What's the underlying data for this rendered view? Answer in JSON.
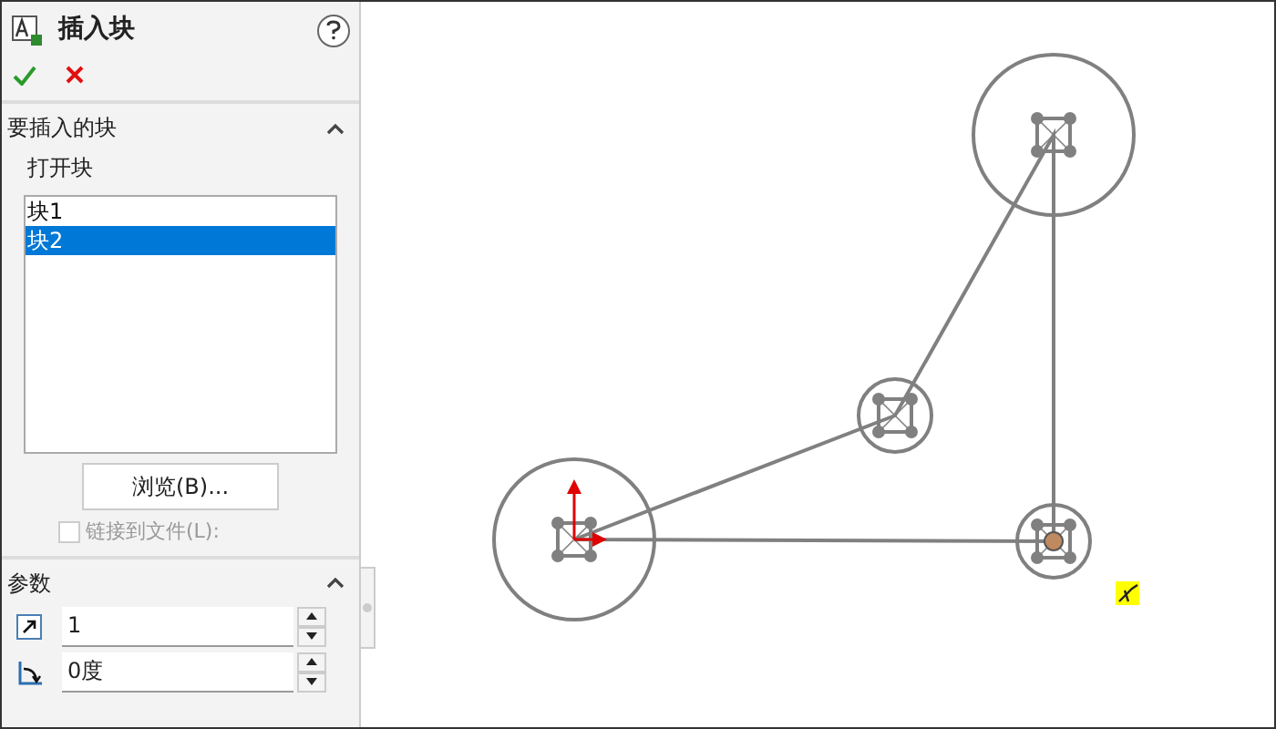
{
  "panel": {
    "title": "插入块",
    "sections": [
      {
        "kind": "blocks",
        "title": "要插入的块",
        "expanded": true,
        "subtitle": "打开块",
        "items": [
          {
            "label": "块1",
            "selected": false
          },
          {
            "label": "块2",
            "selected": true
          }
        ],
        "button": "浏览(B)...",
        "link": {
          "label": "链接到文件(L):",
          "checked": false,
          "disabled": true
        }
      },
      {
        "kind": "params",
        "title": "参数",
        "expanded": true,
        "fields": [
          {
            "kind": "scale",
            "value": "1"
          },
          {
            "kind": "angle",
            "value": "0度"
          }
        ]
      }
    ]
  }
}
